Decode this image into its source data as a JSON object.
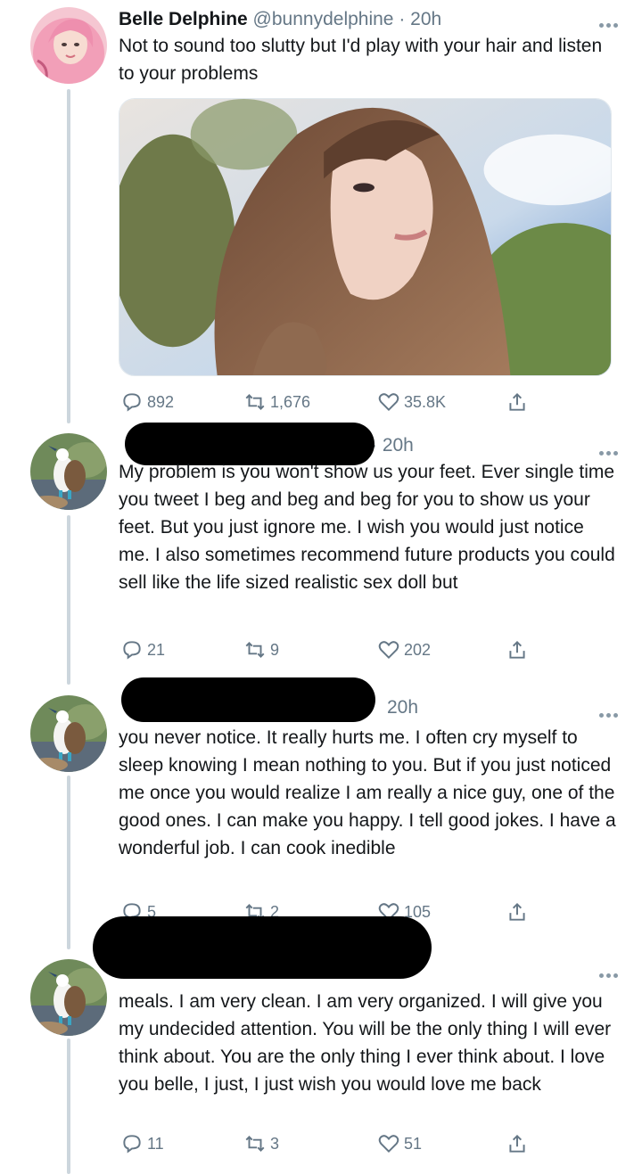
{
  "tweets": [
    {
      "name": "Belle Delphine",
      "handle": "@bunnydelphine",
      "time": "20h",
      "text": "Not to sound too slutty but I'd play with your hair and listen to your problems",
      "replies": "892",
      "retweets": "1,676",
      "likes": "35.8K",
      "avatar_icon": "pink-hair-avatar"
    },
    {
      "name": "",
      "handle": "",
      "time": "20h",
      "text": "My problem is you won't show us your feet. Ever single time you tweet I beg and beg and beg for you to show us your feet. But you just ignore me. I wish you would just notice me. I also sometimes recommend future products you could sell like the life sized realistic sex doll but",
      "replies": "21",
      "retweets": "9",
      "likes": "202",
      "avatar_icon": "bird-avatar"
    },
    {
      "name": "",
      "handle": "",
      "time": "20h",
      "text": "you never notice. It really hurts me. I often cry myself to sleep knowing I mean nothing to you. But if you just noticed me once you would realize I am really a nice guy, one of the good ones. I can make you happy. I tell good jokes. I have a wonderful job. I can cook inedible",
      "replies": "5",
      "retweets": "2",
      "likes": "105",
      "avatar_icon": "bird-avatar"
    },
    {
      "name": "",
      "handle": "",
      "time": "",
      "text": "meals. I am very clean. I am very organized. I will give you my undecided attention. You will be the only thing I will ever think about. You are the only thing I ever think about. I love you belle, I just, I just wish you would love me back",
      "replies": "11",
      "retweets": "3",
      "likes": "51",
      "avatar_icon": "bird-avatar"
    }
  ],
  "colors": {
    "text": "#14171a",
    "muted": "#657786",
    "thread": "#ccd6dd",
    "redaction": "#000000"
  }
}
